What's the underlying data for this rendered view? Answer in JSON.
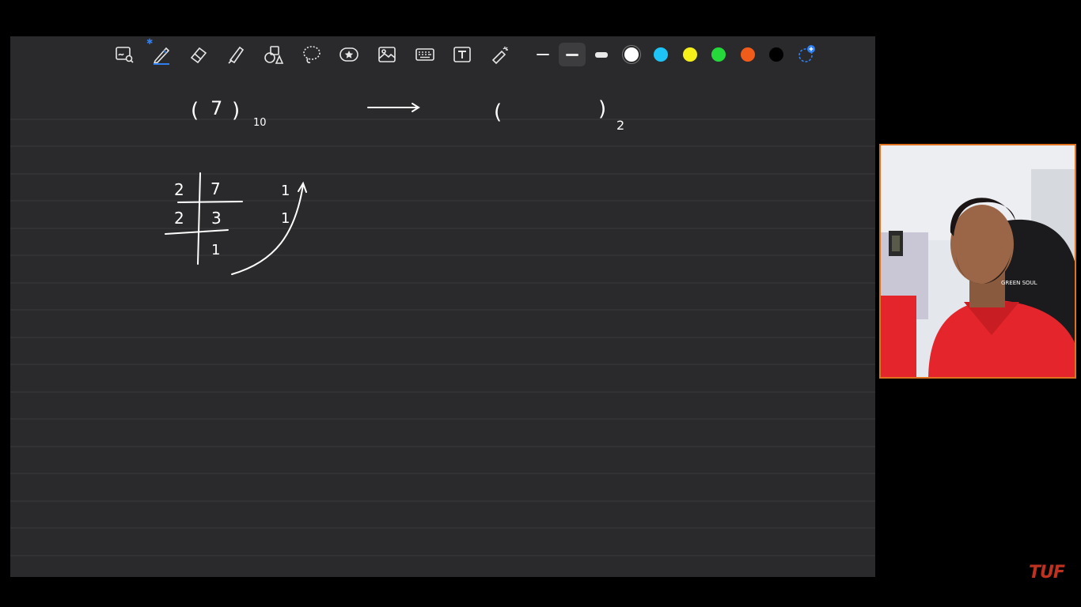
{
  "toolbar": {
    "tools": [
      {
        "name": "lasso-zoom-icon"
      },
      {
        "name": "pen-icon",
        "active": true,
        "badge": "bluetooth"
      },
      {
        "name": "eraser-icon"
      },
      {
        "name": "highlighter-icon"
      },
      {
        "name": "shapes-icon"
      },
      {
        "name": "lasso-icon"
      },
      {
        "name": "sticker-icon"
      },
      {
        "name": "image-icon"
      },
      {
        "name": "keyboard-icon"
      },
      {
        "name": "text-icon",
        "label": "T"
      },
      {
        "name": "laser-pointer-icon"
      }
    ],
    "stroke_widths": [
      "thin",
      "medium",
      "thick"
    ],
    "selected_stroke": "medium",
    "colors": [
      "#ffffff",
      "#1ec4f5",
      "#f6f01a",
      "#25d93a",
      "#f25c1a",
      "#000000"
    ],
    "selected_color": "#ffffff"
  },
  "canvas": {
    "background": "#2a2a2c",
    "line_color": "#3a3a3d",
    "ink_color": "#ffffff"
  },
  "handwriting": {
    "left_open": "(",
    "left_value": "7",
    "left_close": ")",
    "left_base": "10",
    "right_open": "(",
    "right_close": ")",
    "right_base": "2",
    "division": {
      "divisors": [
        "2",
        "2"
      ],
      "dividends": [
        "7",
        "3",
        "1"
      ],
      "remainders": [
        "1",
        "1"
      ]
    }
  },
  "webcam": {
    "jersey_text": "GREEN SOUL"
  },
  "watermark": "TUF"
}
